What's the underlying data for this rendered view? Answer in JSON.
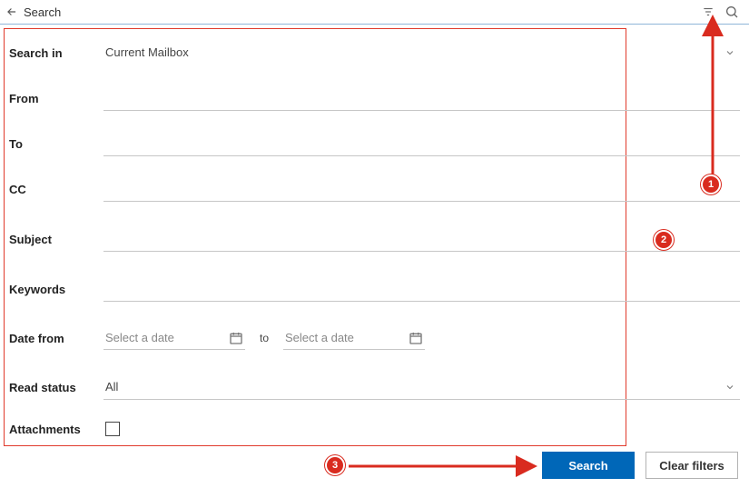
{
  "header": {
    "title": "Search"
  },
  "form": {
    "search_in": {
      "label": "Search in",
      "value": "Current Mailbox"
    },
    "from": {
      "label": "From"
    },
    "to": {
      "label": "To"
    },
    "cc": {
      "label": "CC"
    },
    "subject": {
      "label": "Subject"
    },
    "keywords": {
      "label": "Keywords"
    },
    "date_from": {
      "label": "Date from",
      "placeholder_start": "Select a date",
      "separator": "to",
      "placeholder_end": "Select a date"
    },
    "read_status": {
      "label": "Read status",
      "value": "All"
    },
    "attachments": {
      "label": "Attachments"
    }
  },
  "buttons": {
    "search": "Search",
    "clear": "Clear filters"
  },
  "annotations": {
    "c1": "1",
    "c2": "2",
    "c3": "3"
  }
}
